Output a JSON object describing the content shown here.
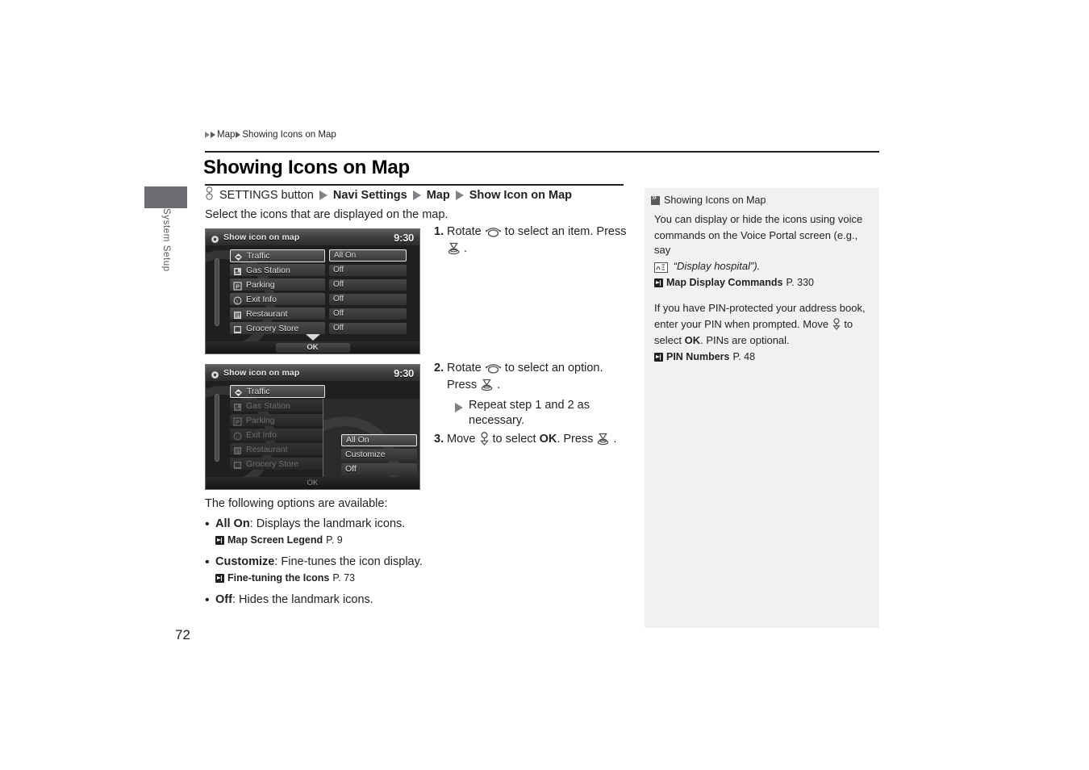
{
  "document": {
    "page_number": "72",
    "side_tab_label": "System Setup",
    "breadcrumb": {
      "parent": "Map",
      "current": "Showing Icons on Map"
    },
    "title": "Showing Icons on Map",
    "nav_path": {
      "button_icon": "settings-button-icon",
      "button_label": "SETTINGS button",
      "segments": [
        "Navi Settings",
        "Map",
        "Show Icon on Map"
      ]
    },
    "intro": "Select the icons that are displayed on the map."
  },
  "screenshot_one": {
    "name": "show-icon-on-map-list-screen",
    "header_title": "Show icon on map",
    "clock": "9:30",
    "ok_label": "OK",
    "rows": [
      {
        "icon": "traffic-icon",
        "label": "Traffic",
        "value": "All On",
        "selected": true,
        "dimmed": false
      },
      {
        "icon": "gas-station-icon",
        "label": "Gas Station",
        "value": "Off",
        "selected": false,
        "dimmed": false
      },
      {
        "icon": "parking-icon",
        "label": "Parking",
        "value": "Off",
        "selected": false,
        "dimmed": false
      },
      {
        "icon": "exit-info-icon",
        "label": "Exit Info",
        "value": "Off",
        "selected": false,
        "dimmed": false
      },
      {
        "icon": "restaurant-icon",
        "label": "Restaurant",
        "value": "Off",
        "selected": false,
        "dimmed": false
      },
      {
        "icon": "grocery-store-icon",
        "label": "Grocery Store",
        "value": "Off",
        "selected": false,
        "dimmed": false
      }
    ]
  },
  "screenshot_two": {
    "name": "show-icon-on-map-option-popup-screen",
    "header_title": "Show icon on map",
    "clock": "9:30",
    "ok_label": "OK",
    "rows": [
      {
        "icon": "traffic-icon",
        "label": "Traffic",
        "value": "",
        "selected": true,
        "dimmed": false
      },
      {
        "icon": "gas-station-icon",
        "label": "Gas Station",
        "value": "",
        "selected": false,
        "dimmed": true
      },
      {
        "icon": "parking-icon",
        "label": "Parking",
        "value": "",
        "selected": false,
        "dimmed": true
      },
      {
        "icon": "exit-info-icon",
        "label": "Exit Info",
        "value": "",
        "selected": false,
        "dimmed": true
      },
      {
        "icon": "restaurant-icon",
        "label": "Restaurant",
        "value": "",
        "selected": false,
        "dimmed": true
      },
      {
        "icon": "grocery-store-icon",
        "label": "Grocery Store",
        "value": "",
        "selected": false,
        "dimmed": true
      }
    ],
    "popup_options": [
      {
        "label": "All On",
        "selected": true
      },
      {
        "label": "Customize",
        "selected": false
      },
      {
        "label": "Off",
        "selected": false
      }
    ]
  },
  "steps": {
    "step1": {
      "number": "1.",
      "text_a": "Rotate",
      "icon_a": "rotate-dial-icon",
      "text_b": "to select an item. Press",
      "icon_b": "press-dial-icon",
      "text_c": "."
    },
    "step2": {
      "number": "2.",
      "text_a": "Rotate",
      "icon_a": "rotate-dial-icon",
      "text_b": "to select an option.",
      "text_c": "Press",
      "icon_b": "press-dial-icon",
      "text_d": "."
    },
    "substep": "Repeat step 1 and 2 as necessary.",
    "step3": {
      "number": "3.",
      "text_a": "Move",
      "icon_a": "joystick-down-icon",
      "text_b": "to select",
      "bold": "OK",
      "text_c": ". Press",
      "icon_b": "press-dial-icon",
      "text_d": "."
    }
  },
  "options": {
    "intro": "The following options are available:",
    "items": [
      {
        "name": "All On",
        "desc": ": Displays the landmark icons.",
        "ref": {
          "icon": "jump-reference-icon",
          "title": "Map Screen Legend",
          "page": "P. 9"
        }
      },
      {
        "name": "Customize",
        "desc": ": Fine-tunes the icon display.",
        "ref": {
          "icon": "jump-reference-icon",
          "title": "Fine-tuning the Icons",
          "page": "P. 73"
        }
      },
      {
        "name": "Off",
        "desc": ": Hides the landmark icons.",
        "ref": null
      }
    ]
  },
  "note_panel": {
    "heading": "Showing Icons on Map",
    "heading_icon": "note-marker-icon",
    "paragraph1_a": "You can display or hide the icons using voice",
    "paragraph1_b": "commands on the Voice Portal screen (e.g., say",
    "voice_icon": "voice-command-icon",
    "paragraph1_quote": "“Display hospital”).",
    "ref1": {
      "icon": "jump-reference-icon",
      "title": "Map Display Commands",
      "page": "P. 330"
    },
    "paragraph2_a": "If you have PIN-protected your address book,",
    "paragraph2_b": "enter your PIN when prompted. Move",
    "paragraph2_joystick_icon": "joystick-down-icon",
    "paragraph2_c": "to",
    "paragraph2_d": "select",
    "paragraph2_bold": "OK",
    "paragraph2_e": ". PINs are optional.",
    "ref2": {
      "icon": "jump-reference-icon",
      "title": "PIN Numbers",
      "page": "P. 48"
    }
  },
  "colors": {
    "text": "#231f20",
    "note_panel_bg": "#f1f1f1",
    "tab_gray": "#6d6e71",
    "triangle_gray": "#808285",
    "screen_bg": "#1f1f1f"
  }
}
